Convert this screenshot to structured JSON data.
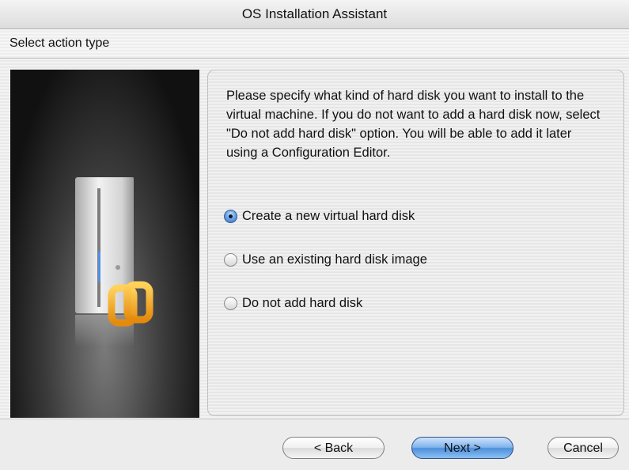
{
  "window": {
    "title": "OS Installation Assistant"
  },
  "section": {
    "title": "Select action type"
  },
  "panel": {
    "description": "Please specify what kind of hard disk you want to install to the virtual machine. If you do not want to add a hard disk now, select \"Do not add hard disk\" option. You will be able to add it later using a Configuration Editor.",
    "options": [
      {
        "label": "Create a new virtual hard disk",
        "selected": true
      },
      {
        "label": "Use an existing hard disk image",
        "selected": false
      },
      {
        "label": "Do not add hard disk",
        "selected": false
      }
    ]
  },
  "buttons": {
    "back": "< Back",
    "next": "Next >",
    "cancel": "Cancel"
  },
  "colors": {
    "accent": "#4d8fdb",
    "logo": "#f0a51c"
  },
  "icons": {
    "illustration": "server-tower-with-parallels-logo"
  }
}
